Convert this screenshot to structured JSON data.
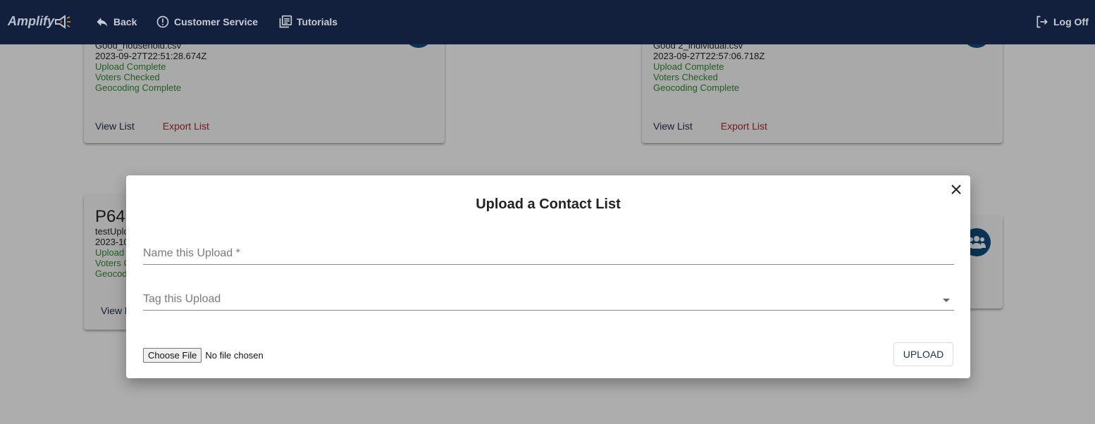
{
  "header": {
    "logo_text": "Amplify",
    "nav": {
      "back": "Back",
      "customer_service": "Customer Service",
      "tutorials": "Tutorials",
      "log_off": "Log Off"
    }
  },
  "cards": [
    {
      "filename": "Good_household.csv",
      "timestamp": "2023-09-27T22:51:28.674Z",
      "statuses": [
        "Upload Complete",
        "Voters Checked",
        "Geocoding Complete"
      ],
      "view_label": "View List",
      "export_label": "Export List"
    },
    {
      "filename": "Good 2_individual.csv",
      "timestamp": "2023-09-27T22:57:06.718Z",
      "statuses": [
        "Upload Complete",
        "Voters Checked",
        "Geocoding Complete"
      ],
      "view_label": "View List",
      "export_label": "Export List"
    },
    {
      "title": "P64",
      "filename": "testUplo",
      "timestamp": "2023-10",
      "statuses": [
        "Upload",
        "Voters C",
        "Geocod"
      ],
      "view_label": "View l"
    }
  ],
  "modal": {
    "title": "Upload a Contact List",
    "name_field": {
      "placeholder": "Name this Upload *",
      "value": ""
    },
    "tag_field": {
      "placeholder": "Tag this Upload",
      "value": ""
    },
    "file": {
      "button_label": "Choose File",
      "status": "No file chosen"
    },
    "upload_label": "UPLOAD"
  },
  "colors": {
    "header_bg": "#12203d",
    "status_green": "#2e8b2e",
    "export_red": "#a52834",
    "view_navy": "#1f2e4c",
    "avatar_blue": "#0f4d80"
  }
}
